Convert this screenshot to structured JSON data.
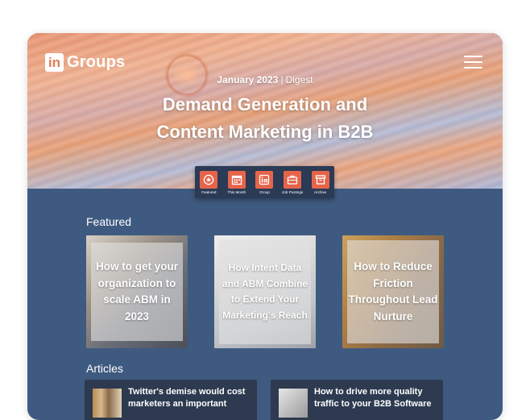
{
  "header": {
    "logo_in": "in",
    "logo_text": "Groups",
    "date": "January 2023",
    "separator": "|",
    "issue_type": "Digest",
    "title_line1": "Demand Generation and",
    "title_line2": "Content Marketing in B2B"
  },
  "nav": [
    {
      "label": "Featured",
      "icon": "star-icon"
    },
    {
      "label": "This Month",
      "icon": "calendar-icon"
    },
    {
      "label": "Group",
      "icon": "linkedin-icon"
    },
    {
      "label": "Job Postings",
      "icon": "briefcase-icon"
    },
    {
      "label": "Archive",
      "icon": "archive-icon"
    }
  ],
  "featured": {
    "heading": "Featured",
    "cards": [
      {
        "title": "How to get your organization to scale ABM in 2023"
      },
      {
        "title": "How Intent Data and ABM Combine to Extend Your Marketing's Reach"
      },
      {
        "title": "How to Reduce Friction Throughout Lead Nurture"
      }
    ]
  },
  "articles": {
    "heading": "Articles",
    "items": [
      {
        "title": "Twitter's demise would cost marketers an important"
      },
      {
        "title": "How to drive more quality traffic to your B2B Software"
      }
    ]
  },
  "colors": {
    "body_bg": "#3f5a80",
    "accent": "#e5654a",
    "nav_bg": "#2b3a55",
    "article_bg": "#2d3a50"
  }
}
